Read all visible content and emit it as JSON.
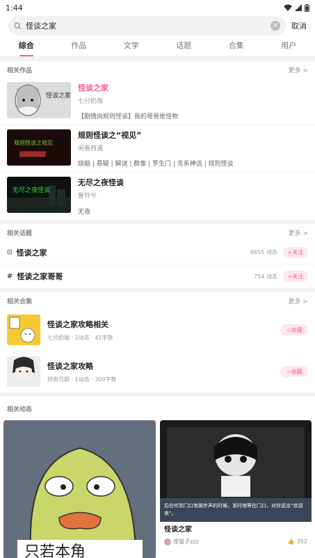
{
  "status_bar": {
    "time": "1:44"
  },
  "search": {
    "query": "怪谈之家",
    "cancel_label": "取消"
  },
  "tabs": [
    {
      "label": "综合",
      "active": true
    },
    {
      "label": "作品",
      "active": false
    },
    {
      "label": "文学",
      "active": false
    },
    {
      "label": "话题",
      "active": false
    },
    {
      "label": "合集",
      "active": false
    },
    {
      "label": "用户",
      "active": false
    }
  ],
  "works": {
    "title": "相关作品",
    "more": "更多 >",
    "items": [
      {
        "title": "怪谈之家",
        "author": "七分奶咖",
        "desc": "【剧情向规则怪谈】我的哥哥是怪物",
        "thumb_text": "怪谈之家"
      },
      {
        "title": "规则怪谈之“视见”",
        "author": "闲看西遇",
        "desc": "烧脑 | 悬疑 | 解谜 | 群像 | 罗生门 | 克系神话 | 规则怪谈",
        "thumb_text": "规则怪谈之视见"
      },
      {
        "title": "无尽之夜怪谈",
        "author": "鲁铃兮",
        "desc": "无夜",
        "thumb_text": "无尽之夜怪谈"
      }
    ]
  },
  "topics": {
    "title": "相关话题",
    "more": "更多 >",
    "items": [
      {
        "icon_glyph": "⊡",
        "name": "怪谈之家",
        "count": "6655 动态",
        "follow": "+关注"
      },
      {
        "icon_glyph": "#",
        "name": "怪谈之家哥哥",
        "count": "754 动态",
        "follow": "+关注"
      }
    ]
  },
  "collections": {
    "title": "相关合集",
    "more": "更多 >",
    "items": [
      {
        "title": "怪谈之家攻略相关",
        "meta": "七分奶咖 · 2动态 · 41字数",
        "collect": "☆收藏"
      },
      {
        "title": "怪谈之家攻略",
        "meta": "倾南司期 · 1动态 · 300字数",
        "collect": "☆收藏"
      }
    ]
  },
  "feed": {
    "title": "相关动态",
    "cards": [
      {
        "caption": "只若本角"
      },
      {
        "overlay_text": "后在听到门口有脚步声的时候，准时地等在门口，对你说出“欢迎来”。",
        "title": "怪谈之家",
        "author": "夜猫子zzz",
        "likes": "352"
      }
    ]
  }
}
